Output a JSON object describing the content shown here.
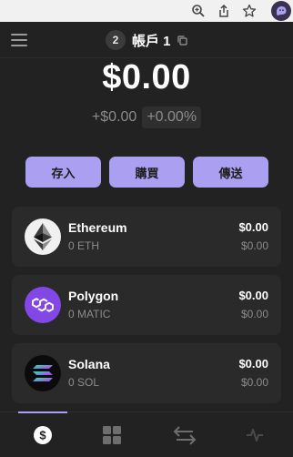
{
  "browser": {
    "icons": [
      "zoom-in-icon",
      "share-icon",
      "star-icon",
      "extension-ghost-icon"
    ]
  },
  "header": {
    "account_number": "2",
    "account_name": "帳戶 1"
  },
  "balance": {
    "total": "$0.00",
    "change_abs": "+$0.00",
    "change_pct": "+0.00%"
  },
  "actions": {
    "deposit": "存入",
    "buy": "購買",
    "send": "傳送"
  },
  "tokens": [
    {
      "name": "Ethereum",
      "amount": "0 ETH",
      "value": "$0.00",
      "change": "$0.00",
      "icon": "ethereum-icon"
    },
    {
      "name": "Polygon",
      "amount": "0 MATIC",
      "value": "$0.00",
      "change": "$0.00",
      "icon": "polygon-icon"
    },
    {
      "name": "Solana",
      "amount": "0 SOL",
      "value": "$0.00",
      "change": "$0.00",
      "icon": "solana-icon"
    }
  ],
  "nav": {
    "items": [
      "wallet-icon",
      "collectibles-icon",
      "swap-icon",
      "activity-icon"
    ],
    "active": "wallet"
  },
  "colors": {
    "accent": "#ab9ff2",
    "background": "#222222",
    "card": "#2a2a2a"
  }
}
